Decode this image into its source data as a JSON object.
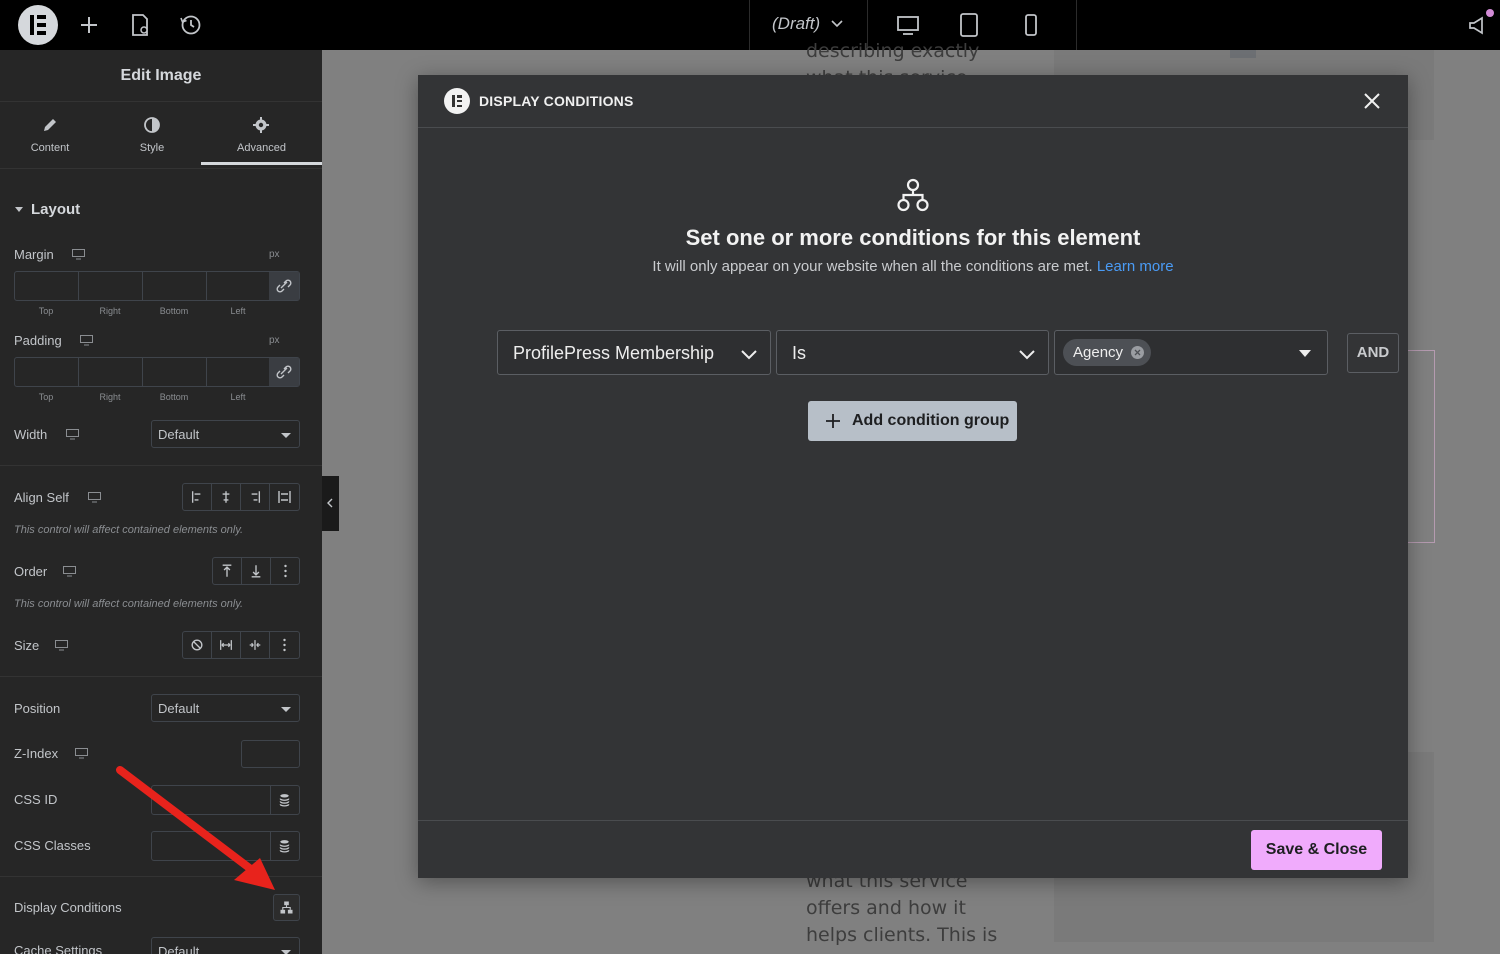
{
  "topbar": {
    "draft_label": "(Draft)",
    "icons": [
      "elementor-logo-icon",
      "plus-icon",
      "page-settings-icon",
      "history-icon",
      "chevron-down-icon",
      "desktop-icon",
      "tablet-icon",
      "mobile-icon",
      "announcement-icon"
    ]
  },
  "panel": {
    "title": "Edit Image",
    "tabs": [
      {
        "label": "Content",
        "icon": "pencil-icon"
      },
      {
        "label": "Style",
        "icon": "contrast-icon"
      },
      {
        "label": "Advanced",
        "icon": "gear-icon",
        "active": true
      }
    ],
    "section_title": "Layout",
    "margin": {
      "label": "Margin",
      "unit": "px",
      "sides": [
        "Top",
        "Right",
        "Bottom",
        "Left"
      ]
    },
    "padding": {
      "label": "Padding",
      "unit": "px",
      "sides": [
        "Top",
        "Right",
        "Bottom",
        "Left"
      ]
    },
    "width": {
      "label": "Width",
      "value": "Default"
    },
    "align_self": {
      "label": "Align Self",
      "note": "This control will affect contained elements only."
    },
    "order": {
      "label": "Order",
      "note": "This control will affect contained elements only."
    },
    "size": {
      "label": "Size"
    },
    "position": {
      "label": "Position",
      "value": "Default"
    },
    "z_index": {
      "label": "Z-Index"
    },
    "css_id": {
      "label": "CSS ID"
    },
    "css_classes": {
      "label": "CSS Classes"
    },
    "display_conditions": {
      "label": "Display Conditions"
    },
    "cache_settings": {
      "label": "Cache Settings",
      "value": "Default"
    }
  },
  "canvas": {
    "text_top": [
      "describing exactly",
      "what this service"
    ],
    "text_bottom": [
      "what this service",
      "offers and how it",
      "helps clients. This is"
    ]
  },
  "modal": {
    "title": "DISPLAY CONDITIONS",
    "heading": "Set one or more conditions for this element",
    "subtitle": "It will only appear on your website when all the conditions are met.",
    "learn_more": "Learn more",
    "condition": {
      "field": "ProfilePress Membership",
      "operator": "Is",
      "value_tag": "Agency",
      "and_label": "AND"
    },
    "add_group_label": "Add condition group",
    "save_label": "Save & Close"
  },
  "colors": {
    "accent_save": "#f0abfc",
    "link": "#4a9bf5",
    "arrow": "#e8231c",
    "modal_bg": "#333436",
    "panel_bg": "#262626"
  }
}
